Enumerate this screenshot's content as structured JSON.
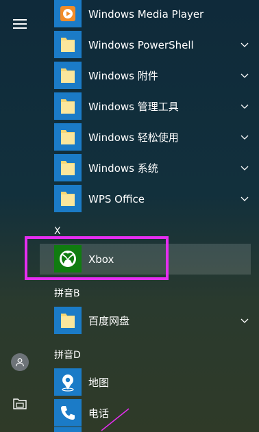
{
  "rail": {
    "menu_icon": "hamburger-icon",
    "user_icon": "user-icon",
    "documents_icon": "folder-icon"
  },
  "apps": [
    {
      "label": "Windows Media Player",
      "icon": "media-player-icon",
      "expandable": false
    },
    {
      "label": "Windows PowerShell",
      "icon": "folder-icon",
      "expandable": true
    },
    {
      "label": "Windows 附件",
      "icon": "folder-icon",
      "expandable": true
    },
    {
      "label": "Windows 管理工具",
      "icon": "folder-icon",
      "expandable": true
    },
    {
      "label": "Windows 轻松使用",
      "icon": "folder-icon",
      "expandable": true
    },
    {
      "label": "Windows 系统",
      "icon": "folder-icon",
      "expandable": true
    },
    {
      "label": "WPS Office",
      "icon": "folder-icon",
      "expandable": true
    }
  ],
  "group_x": "X",
  "xbox": {
    "label": "Xbox",
    "icon": "xbox-icon"
  },
  "group_b": "拼音B",
  "baidu": {
    "label": "百度网盘",
    "icon": "folder-icon",
    "expandable": true
  },
  "group_d": "拼音D",
  "maps": {
    "label": "地图",
    "icon": "map-pin-icon"
  },
  "phone": {
    "label": "电话",
    "icon": "phone-icon"
  },
  "colors": {
    "highlight": "#e52ef0",
    "tile_blue": "#1b7bc7",
    "xbox_green": "#107c10",
    "folder_yellow": "#f7d774"
  }
}
